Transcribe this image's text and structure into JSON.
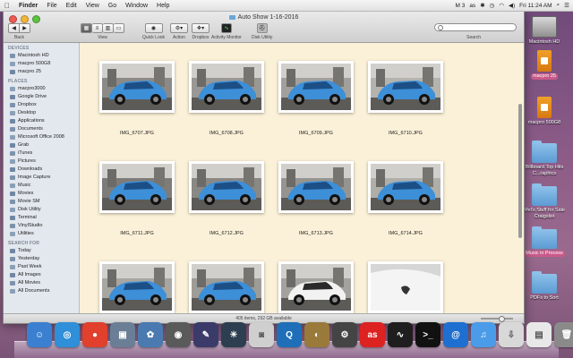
{
  "menubar": {
    "app_name": "Finder",
    "items": [
      "File",
      "Edit",
      "View",
      "Go",
      "Window",
      "Help"
    ],
    "clock": "Fri 11:24 AM",
    "status_text": "M 3"
  },
  "window": {
    "title": "Auto Show 1-16-2016",
    "toolbar": {
      "back_label": "Back",
      "view_label": "View",
      "quicklook_label": "Quick Look",
      "action_label": "Action",
      "dropbox_label": "Dropbox",
      "activity_label": "Activity Monitor",
      "diskutility_label": "Disk Utility",
      "search_label": "Search"
    },
    "sidebar": {
      "sections": [
        {
          "title": "DEVICES",
          "items": [
            "Macintosh HD",
            "macpro 500G8",
            "macpro 25"
          ]
        },
        {
          "title": "PLACES",
          "items": [
            "macpro3000",
            "Google Drive",
            "Dropbox",
            "Desktop",
            "Applications",
            "Documents",
            "Microsoft Office 2008",
            "Grab",
            "iTunes",
            "Pictures",
            "Downloads",
            "Image Capture",
            "Music",
            "Movies",
            "Movie SM",
            "Disk Utility",
            "Terminal",
            "VinylStudio",
            "Utilities"
          ]
        },
        {
          "title": "SEARCH FOR",
          "items": [
            "Today",
            "Yesterday",
            "Past Week",
            "All Images",
            "All Movies",
            "All Documents"
          ]
        }
      ]
    },
    "files": [
      {
        "name": "IMG_6707.JPG",
        "car": "blue",
        "bg": "#8c8a86"
      },
      {
        "name": "IMG_6708.JPG",
        "car": "blue",
        "bg": "#9a9894"
      },
      {
        "name": "IMG_6709.JPG",
        "car": "blue",
        "bg": "#a2a09c"
      },
      {
        "name": "IMG_6710.JPG",
        "car": "blue",
        "bg": "#b5b3ae"
      },
      {
        "name": "IMG_6711.JPG",
        "car": "blue",
        "bg": "#7e7c78"
      },
      {
        "name": "IMG_6712.JPG",
        "car": "blue",
        "bg": "#8a8884"
      },
      {
        "name": "IMG_6713.JPG",
        "car": "blue",
        "bg": "#969490"
      },
      {
        "name": "IMG_6714.JPG",
        "car": "blue",
        "bg": "#b0aea9"
      },
      {
        "name": "",
        "car": "blue",
        "bg": "#a8a6a1"
      },
      {
        "name": "",
        "car": "blue",
        "bg": "#9e9c97"
      },
      {
        "name": "",
        "car": "white",
        "bg": "#a4a29e"
      },
      {
        "name": "",
        "car": "detail",
        "bg": "#d6d6d6"
      }
    ],
    "status": "405 items, 292 GB available"
  },
  "desktop": [
    {
      "label": "Macintosh HD",
      "kind": "hd",
      "selected": false
    },
    {
      "label": "macpro 25",
      "kind": "usb",
      "selected": true
    },
    {
      "label": "macpro 500G8",
      "kind": "usb",
      "selected": false
    },
    {
      "label": "Billboard Top Hits C...raphics",
      "kind": "folder",
      "selected": false
    },
    {
      "label": "Mel's Stuff for Sale Craigslist",
      "kind": "folder",
      "selected": false
    },
    {
      "label": "Music in Process",
      "kind": "folder",
      "selected": true
    },
    {
      "label": "PDFs to Sort",
      "kind": "folder",
      "selected": false
    }
  ],
  "dock": [
    {
      "name": "finder-icon",
      "color": "#3b7fd0",
      "glyph": "☺"
    },
    {
      "name": "safari-icon",
      "color": "#2f8fd8",
      "glyph": "◎"
    },
    {
      "name": "chrome-icon",
      "color": "#e0402c",
      "glyph": "●"
    },
    {
      "name": "preview-icon",
      "color": "#6a7f95",
      "glyph": "▣"
    },
    {
      "name": "iphoto-icon",
      "color": "#4a7ab0",
      "glyph": "✿"
    },
    {
      "name": "iphoto-camera-icon",
      "color": "#5a5a5a",
      "glyph": "◉"
    },
    {
      "name": "instruments-icon",
      "color": "#3b3b6a",
      "glyph": "✎"
    },
    {
      "name": "aperture-icon",
      "color": "#2c3e50",
      "glyph": "☀"
    },
    {
      "name": "screenshot-icon",
      "color": "#cfcfcf",
      "glyph": "◙"
    },
    {
      "name": "quicktime-icon",
      "color": "#1f6fb8",
      "glyph": "Q"
    },
    {
      "name": "logic-icon",
      "color": "#9a7a3a",
      "glyph": "◐"
    },
    {
      "name": "compressor-icon",
      "color": "#444",
      "glyph": "⚙"
    },
    {
      "name": "lastfm-icon",
      "color": "#d22",
      "glyph": "as"
    },
    {
      "name": "activity-monitor-icon",
      "color": "#1e1e1e",
      "glyph": "∿"
    },
    {
      "name": "terminal-icon",
      "color": "#111",
      "glyph": ">_"
    },
    {
      "name": "app-store-icon",
      "color": "#1e6fd0",
      "glyph": "@"
    },
    {
      "name": "itunes-icon",
      "color": "#4a9be8",
      "glyph": "♫"
    },
    {
      "name": "downloads-stack-icon",
      "color": "#d8d8d8",
      "glyph": "⇩"
    },
    {
      "name": "documents-stack-icon",
      "color": "#e8e8e8",
      "glyph": "▤"
    },
    {
      "name": "trash-icon",
      "color": "#8a8a8a",
      "glyph": "🗑"
    }
  ]
}
